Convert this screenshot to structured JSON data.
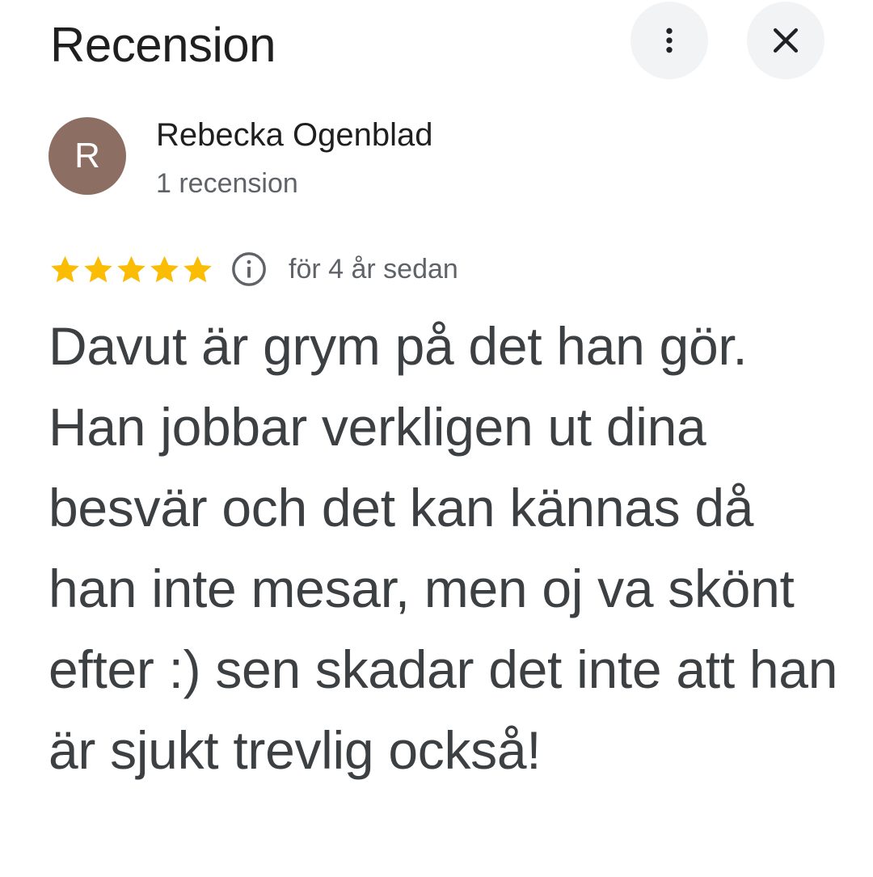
{
  "header": {
    "title": "Recension",
    "more_icon": "more-vert-icon",
    "close_icon": "close-icon"
  },
  "author": {
    "initial": "R",
    "name": "Rebecka Ogenblad",
    "meta": "1 recension",
    "avatar_color": "#8d6e63"
  },
  "rating": {
    "stars": 5,
    "max_stars": 5,
    "star_color": "#fbbc04",
    "info_icon": "info-icon",
    "time_ago": "för 4 år sedan"
  },
  "review": {
    "text": "Davut är grym på det han gör. Han jobbar verkligen ut dina besvär och det kan kännas då han inte mesar, men oj va skönt efter :) sen skadar det inte att han är sjukt trevlig också!"
  }
}
